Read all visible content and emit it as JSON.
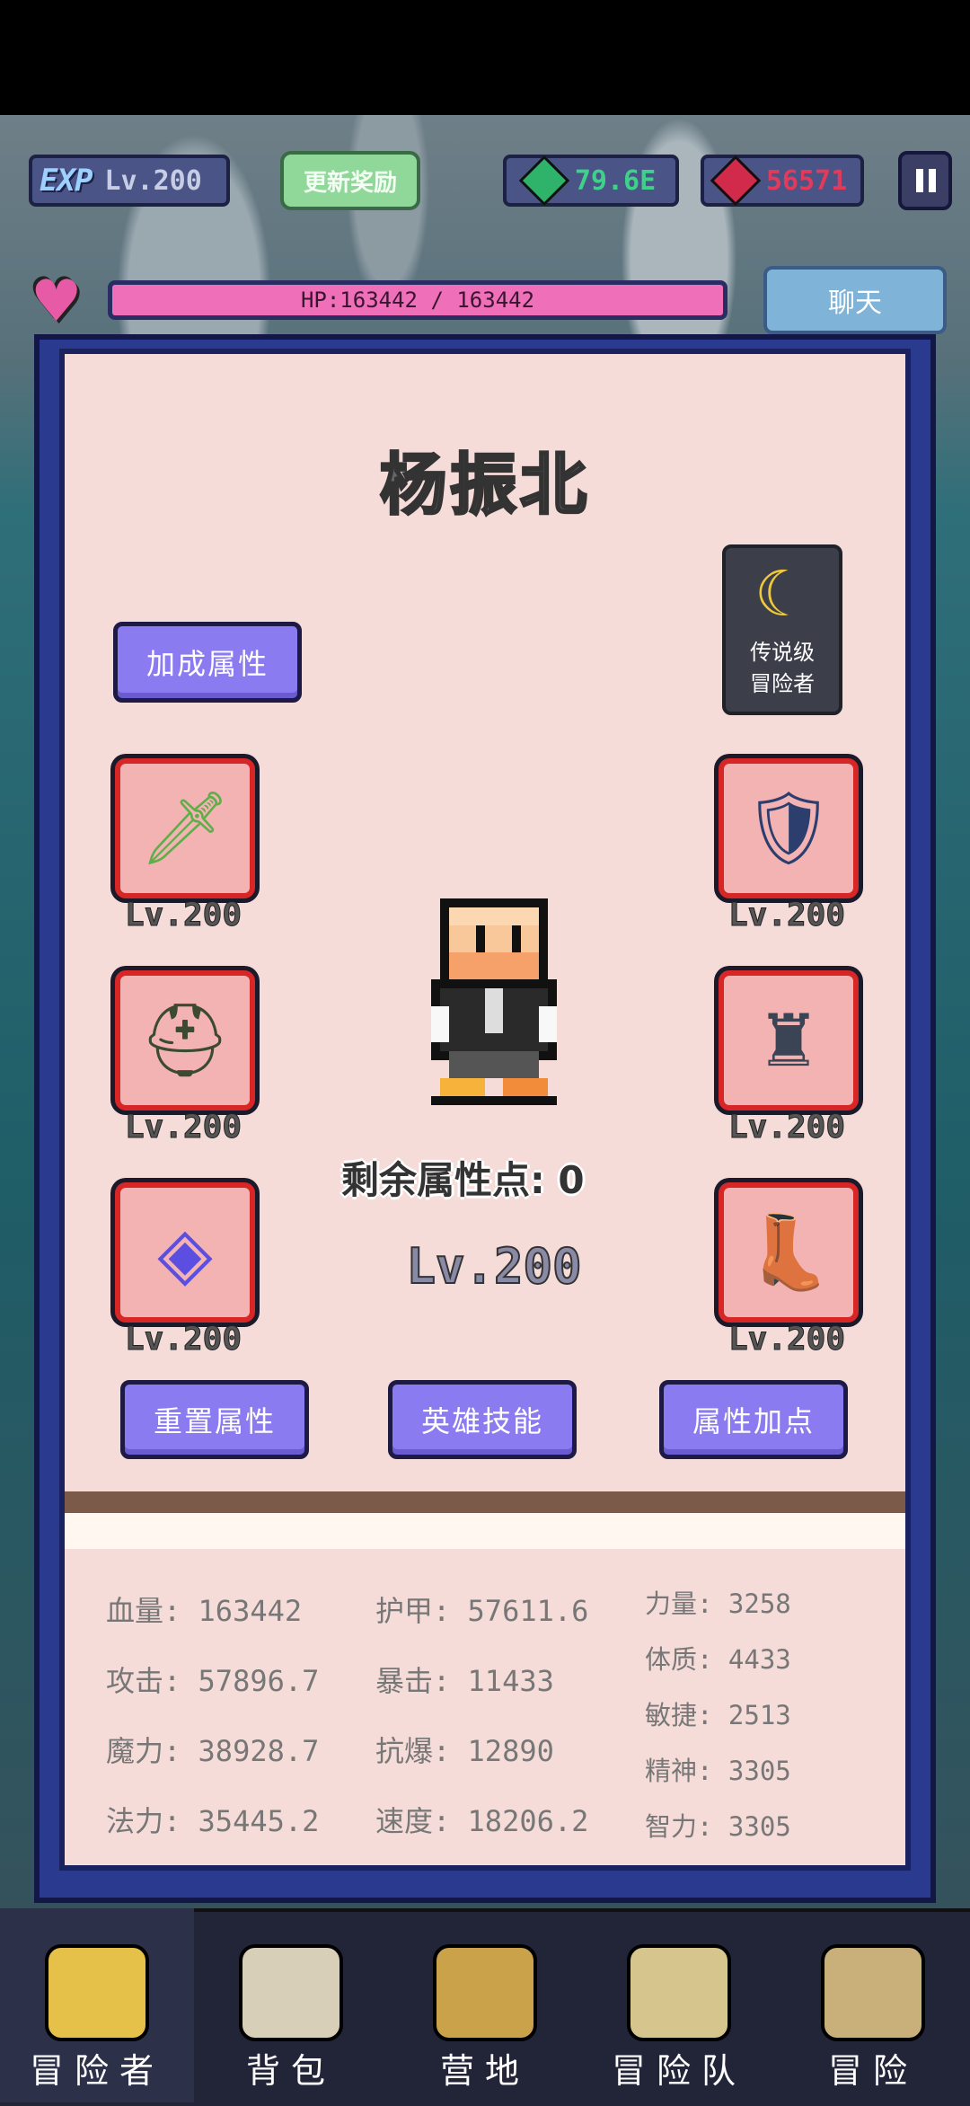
{
  "hud": {
    "exp_badge": "EXP",
    "level": "Lv.200",
    "refresh_label": "更新奖励",
    "emerald_amount": "79.6E",
    "ruby_amount": "56571"
  },
  "hp": {
    "text": "HP:163442 / 163442"
  },
  "chat_label": "聊天",
  "hero": {
    "name": "杨振北",
    "rank_line1": "传说级",
    "rank_line2": "冒险者",
    "bonus_button": "加成属性",
    "remaining_points": "剩余属性点: 0",
    "level": "Lv.200"
  },
  "equipment": [
    {
      "name": "sword",
      "level": "Lv.200"
    },
    {
      "name": "shield",
      "level": "Lv.200"
    },
    {
      "name": "helmet",
      "level": "Lv.200"
    },
    {
      "name": "armor",
      "level": "Lv.200"
    },
    {
      "name": "necklace",
      "level": "Lv.200"
    },
    {
      "name": "boots",
      "level": "Lv.200"
    }
  ],
  "actions": {
    "reset": "重置属性",
    "skills": "英雄技能",
    "add_points": "属性加点"
  },
  "stats_col1": [
    "血量: 163442",
    "攻击: 57896.7",
    "魔力: 38928.7",
    "法力: 35445.2"
  ],
  "stats_col2": [
    "护甲: 57611.6",
    "暴击: 11433",
    "抗爆: 12890",
    "速度: 18206.2"
  ],
  "stats_col3": [
    "力量: 3258",
    "体质: 4433",
    "敏捷: 2513",
    "精神: 3305",
    "智力: 3305"
  ],
  "nav": [
    "冒险者",
    "背包",
    "营地",
    "冒险队",
    "冒险"
  ],
  "colors": {
    "panel": "#2a3a8f",
    "button": "#8a7cf0",
    "slot_border": "#d62626"
  }
}
